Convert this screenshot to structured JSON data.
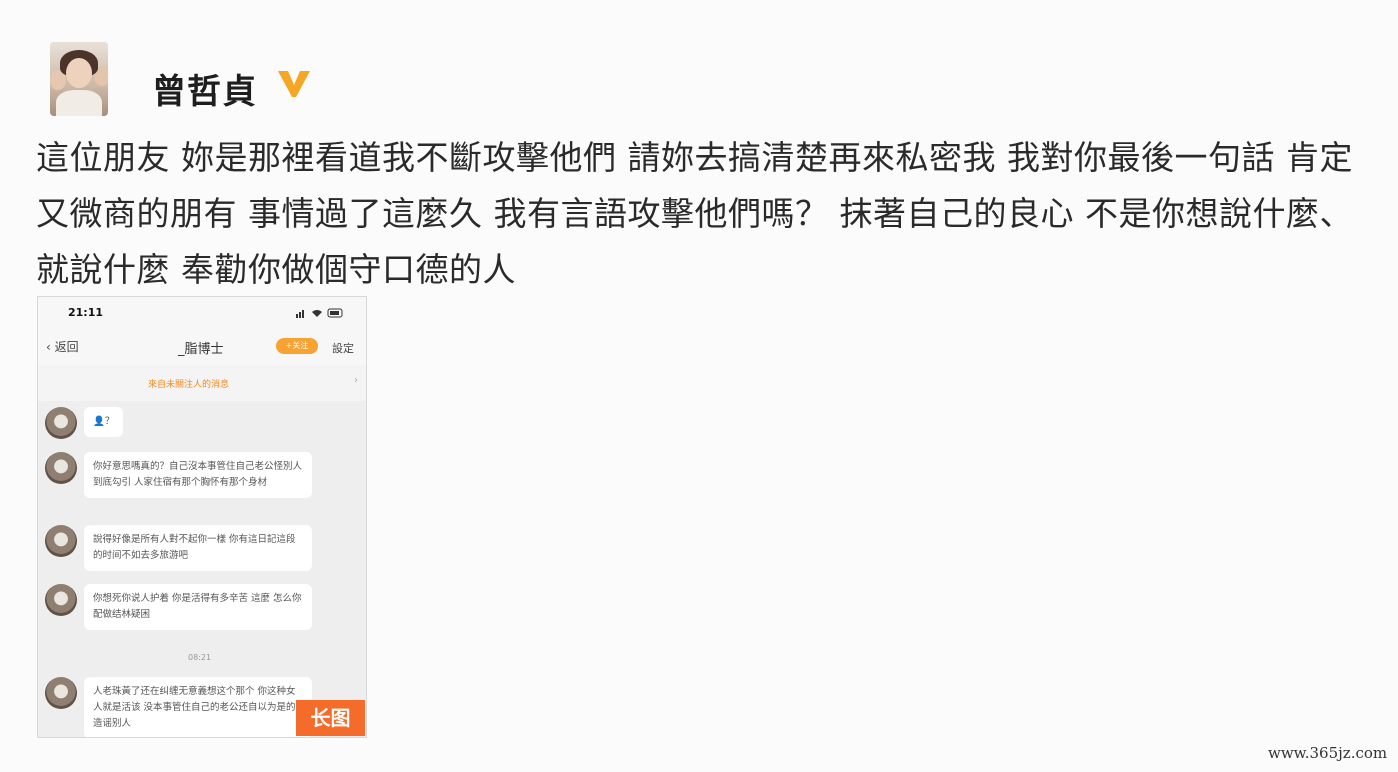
{
  "user": {
    "name": "曾哲貞",
    "verified_color": "#f5a623"
  },
  "post": {
    "text": "這位朋友 妳是那裡看道我不斷攻擊他們 請妳去搞清楚再來私密我 我對你最後一句話 肯定又微商的朋有 事情過了這麼久 我有言語攻擊他們嗎？ 抹著自己的良心 不是你想說什麼、就說什麼 奉勸你做個守口德的人"
  },
  "phone": {
    "status_time": "21:11",
    "nav": {
      "back_label": "返回",
      "title": "_脂博士",
      "follow_label": "+关注",
      "settings_label": "設定"
    },
    "banner": "來自未關注人的消息",
    "messages": [
      {
        "text": "👤？"
      },
      {
        "text": "你好意思嗎真的？自己沒本事管住自己老公怪別人到底勾引 人家住宿有那个胸怀有那个身材"
      },
      {
        "text": "說得好像是所有人對不起你一樣 你有這日記這段的时间不如去多旅游吧"
      },
      {
        "text": "你想死你说人护着 你是活得有多辛苦 這麼 怎么你配做结林疑困"
      },
      {
        "text": "人老珠黃了还在纠缠无意義想这个那个 你这种女人就是活该 没本事管住自己的老公还自以为是的造谣别人"
      }
    ],
    "timestamp": "08:21"
  },
  "badge": {
    "label": "长图"
  },
  "watermark": "www.365jz.com"
}
